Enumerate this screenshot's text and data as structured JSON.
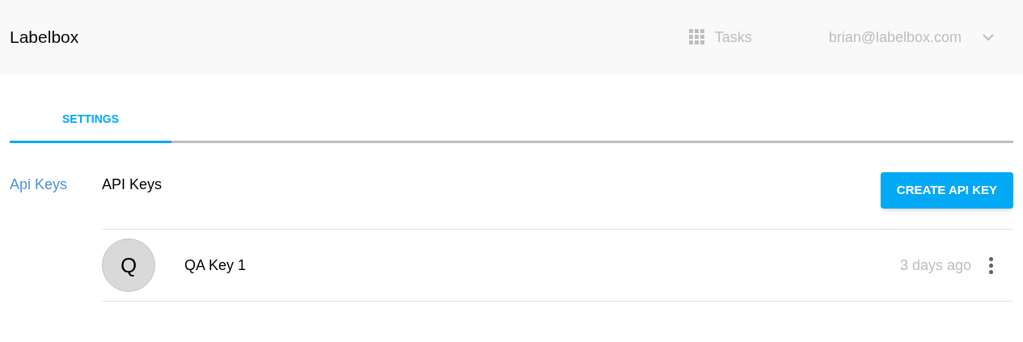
{
  "header": {
    "logo": "Labelbox",
    "tasks": "Tasks",
    "user": "brian@labelbox.com"
  },
  "tabs": [
    {
      "label": "SETTINGS",
      "selected": true
    }
  ],
  "sidebar": {
    "items": [
      {
        "label": "Api Keys",
        "selected": true
      }
    ]
  },
  "section": {
    "title": "API Keys",
    "button": "CREATE API KEY"
  },
  "keys": [
    {
      "initial": "Q",
      "name": "QA Key 1",
      "time": "3 days ago"
    }
  ]
}
